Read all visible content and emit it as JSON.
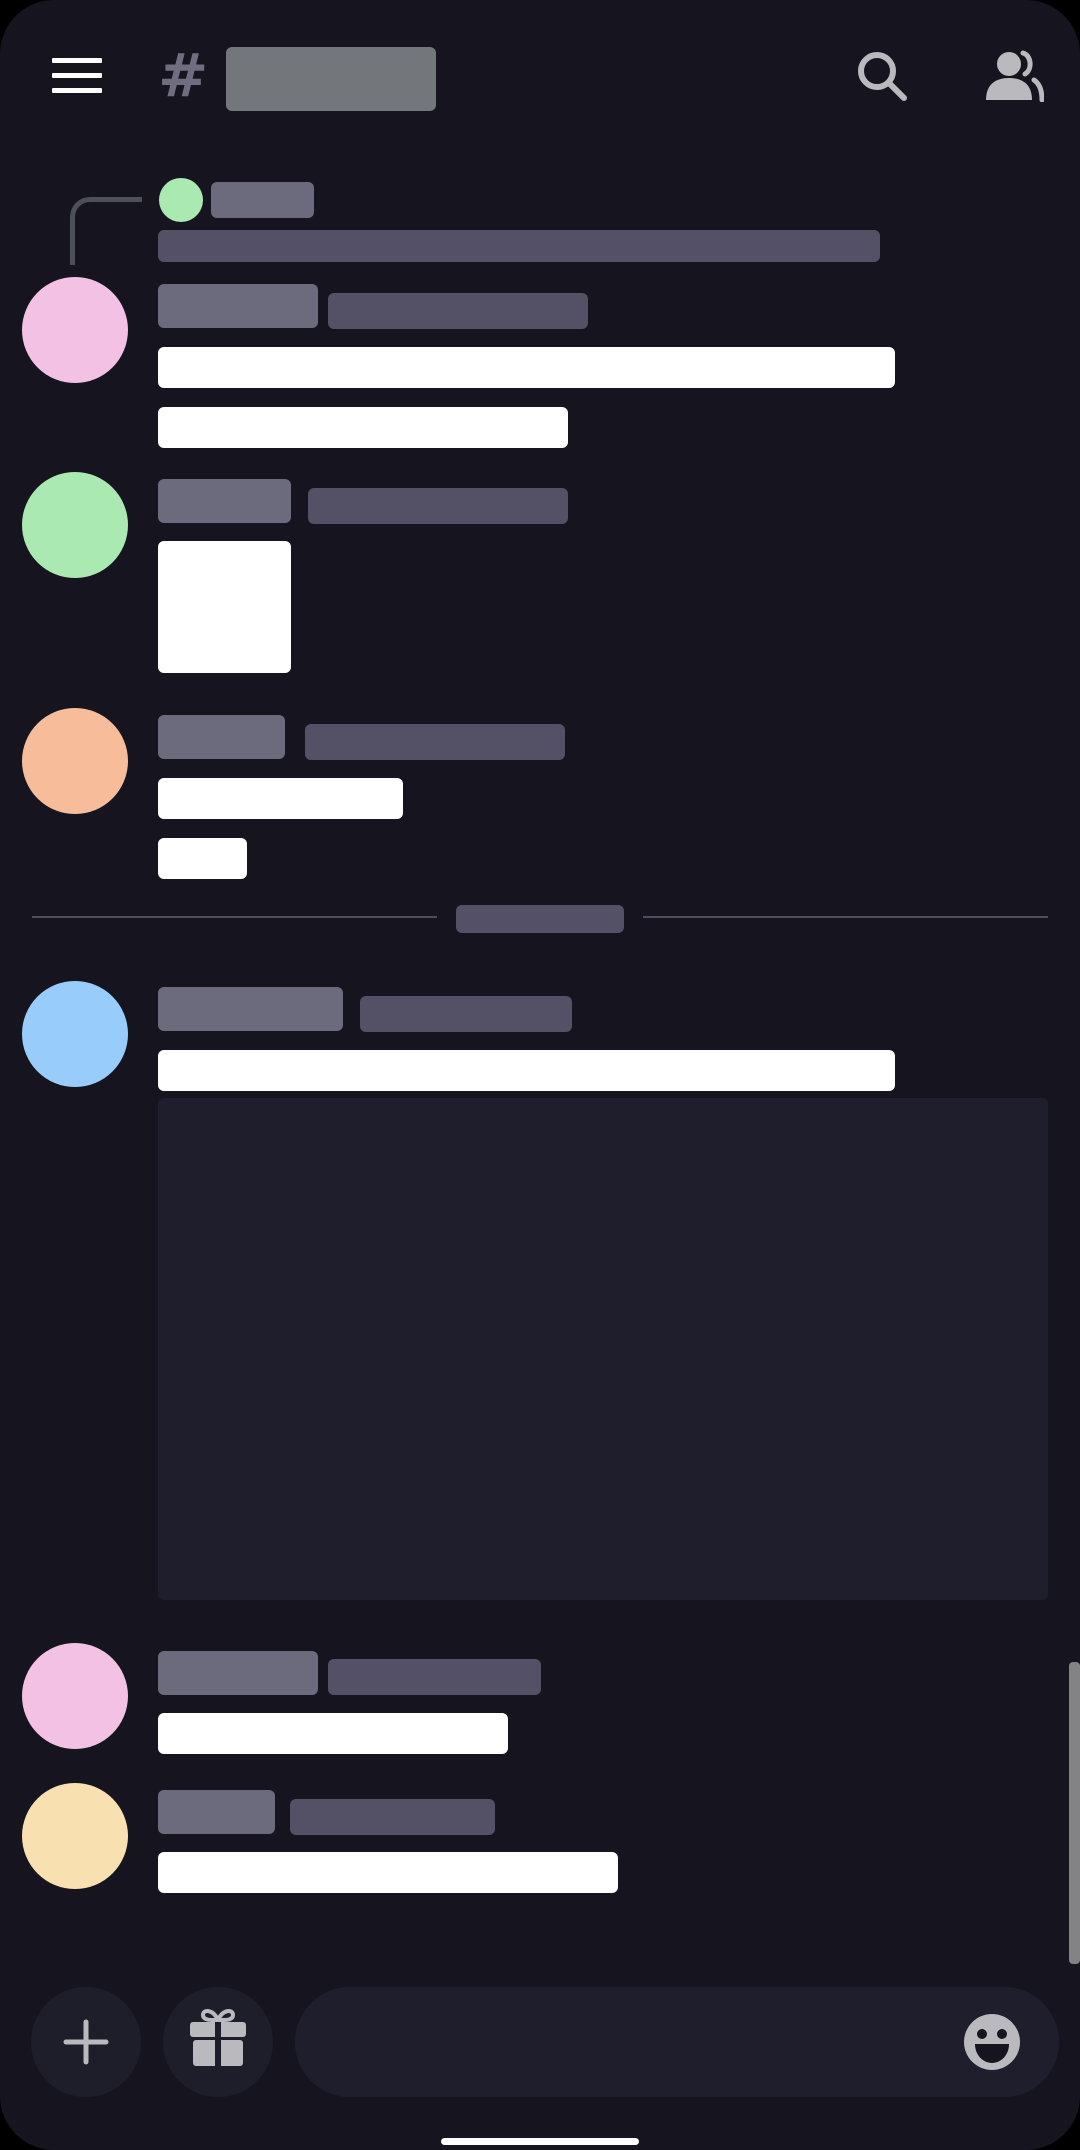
{
  "header": {
    "menu_icon": "hamburger-menu-icon",
    "channel_icon": "hash-icon",
    "channel_glyph": "#",
    "search_icon": "search-icon",
    "members_icon": "members-icon"
  },
  "composer": {
    "add_icon": "plus-icon",
    "gift_icon": "gift-icon",
    "emoji_icon": "emoji-icon",
    "placeholder": ""
  },
  "colors": {
    "background": "#16151f",
    "name_placeholder": "#6c6a7d",
    "timestamp_placeholder": "#545066",
    "message_placeholder": "#ffffff",
    "avatar_pink": "#f2c1e4",
    "avatar_green": "#abe9b2",
    "avatar_orange": "#f7bd9a",
    "avatar_blue": "#98cdfb",
    "avatar_yellow": "#f8e0b0",
    "embed_background": "#1f1e2d",
    "icon_gray": "#b9b9be"
  }
}
